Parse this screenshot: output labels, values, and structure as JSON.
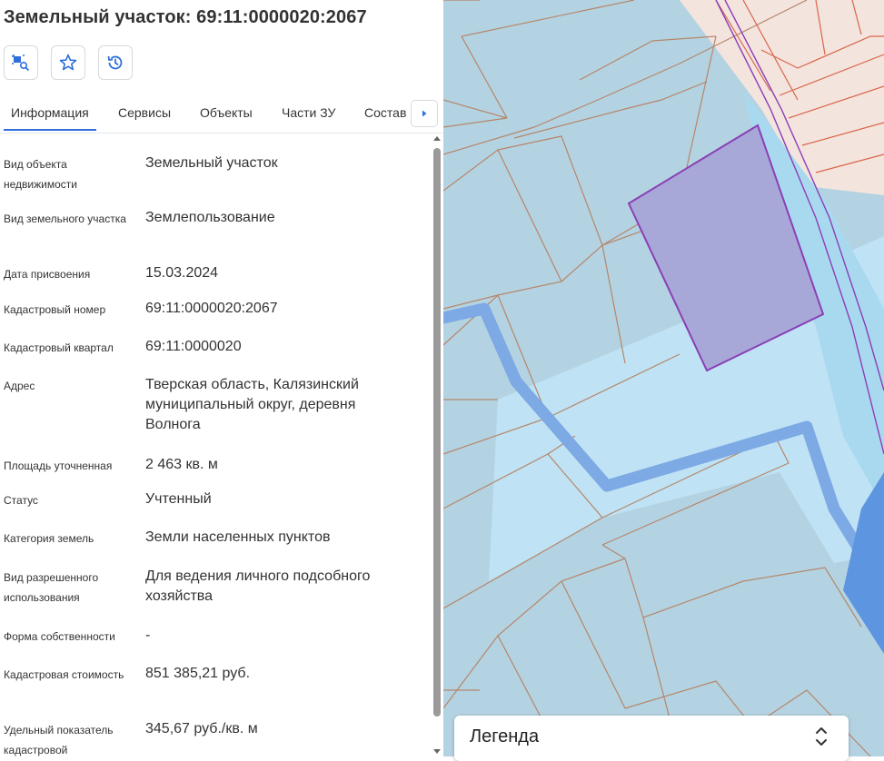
{
  "header": {
    "title": "Земельный участок: 69:11:0000020:2067"
  },
  "toolbar": {
    "buttons": [
      {
        "icon": "locate-on-map-icon"
      },
      {
        "icon": "star-icon"
      },
      {
        "icon": "history-icon"
      }
    ]
  },
  "tabs": [
    {
      "label": "Информация",
      "active": true
    },
    {
      "label": "Сервисы",
      "active": false
    },
    {
      "label": "Объекты",
      "active": false
    },
    {
      "label": "Части ЗУ",
      "active": false
    },
    {
      "label": "Состав",
      "active": false
    }
  ],
  "info": {
    "rows": [
      {
        "label": "Вид объекта недвижимости",
        "value": "Земельный участок"
      },
      {
        "label": "Вид земельного участка",
        "value": "Землепользование"
      },
      {
        "label": "Дата присвоения",
        "value": "15.03.2024"
      },
      {
        "label": "Кадастровый номер",
        "value": "69:11:0000020:2067"
      },
      {
        "label": "Кадастровый квартал",
        "value": "69:11:0000020"
      },
      {
        "label": "Адрес",
        "value": "Тверская область, Калязинский муниципальный округ, деревня Волнога"
      },
      {
        "label": "Площадь уточненная",
        "value": "2 463 кв. м"
      },
      {
        "label": "Статус",
        "value": "Учтенный"
      },
      {
        "label": "Категория земель",
        "value": "Земли населенных пунктов"
      },
      {
        "label": "Вид разрешенного использования",
        "value": "Для ведения личного подсобного хозяйства"
      },
      {
        "label": "Форма собственности",
        "value": "-"
      },
      {
        "label": "Кадастровая стоимость",
        "value": "851 385,21 руб."
      },
      {
        "label": "Удельный показатель кадастровой",
        "value": "345,67 руб./кв. м"
      }
    ]
  },
  "legend": {
    "title": "Легенда"
  },
  "colors": {
    "accent": "#2f6fdc",
    "map_parcel_fill": "#b4d3e2",
    "map_zone_fill": "#bfe3f4",
    "selected_parcel": "#a8a8d8",
    "selected_border": "#8a3fb6",
    "road": "#7da9e4",
    "neighbor_zone": "#f4e4de"
  }
}
